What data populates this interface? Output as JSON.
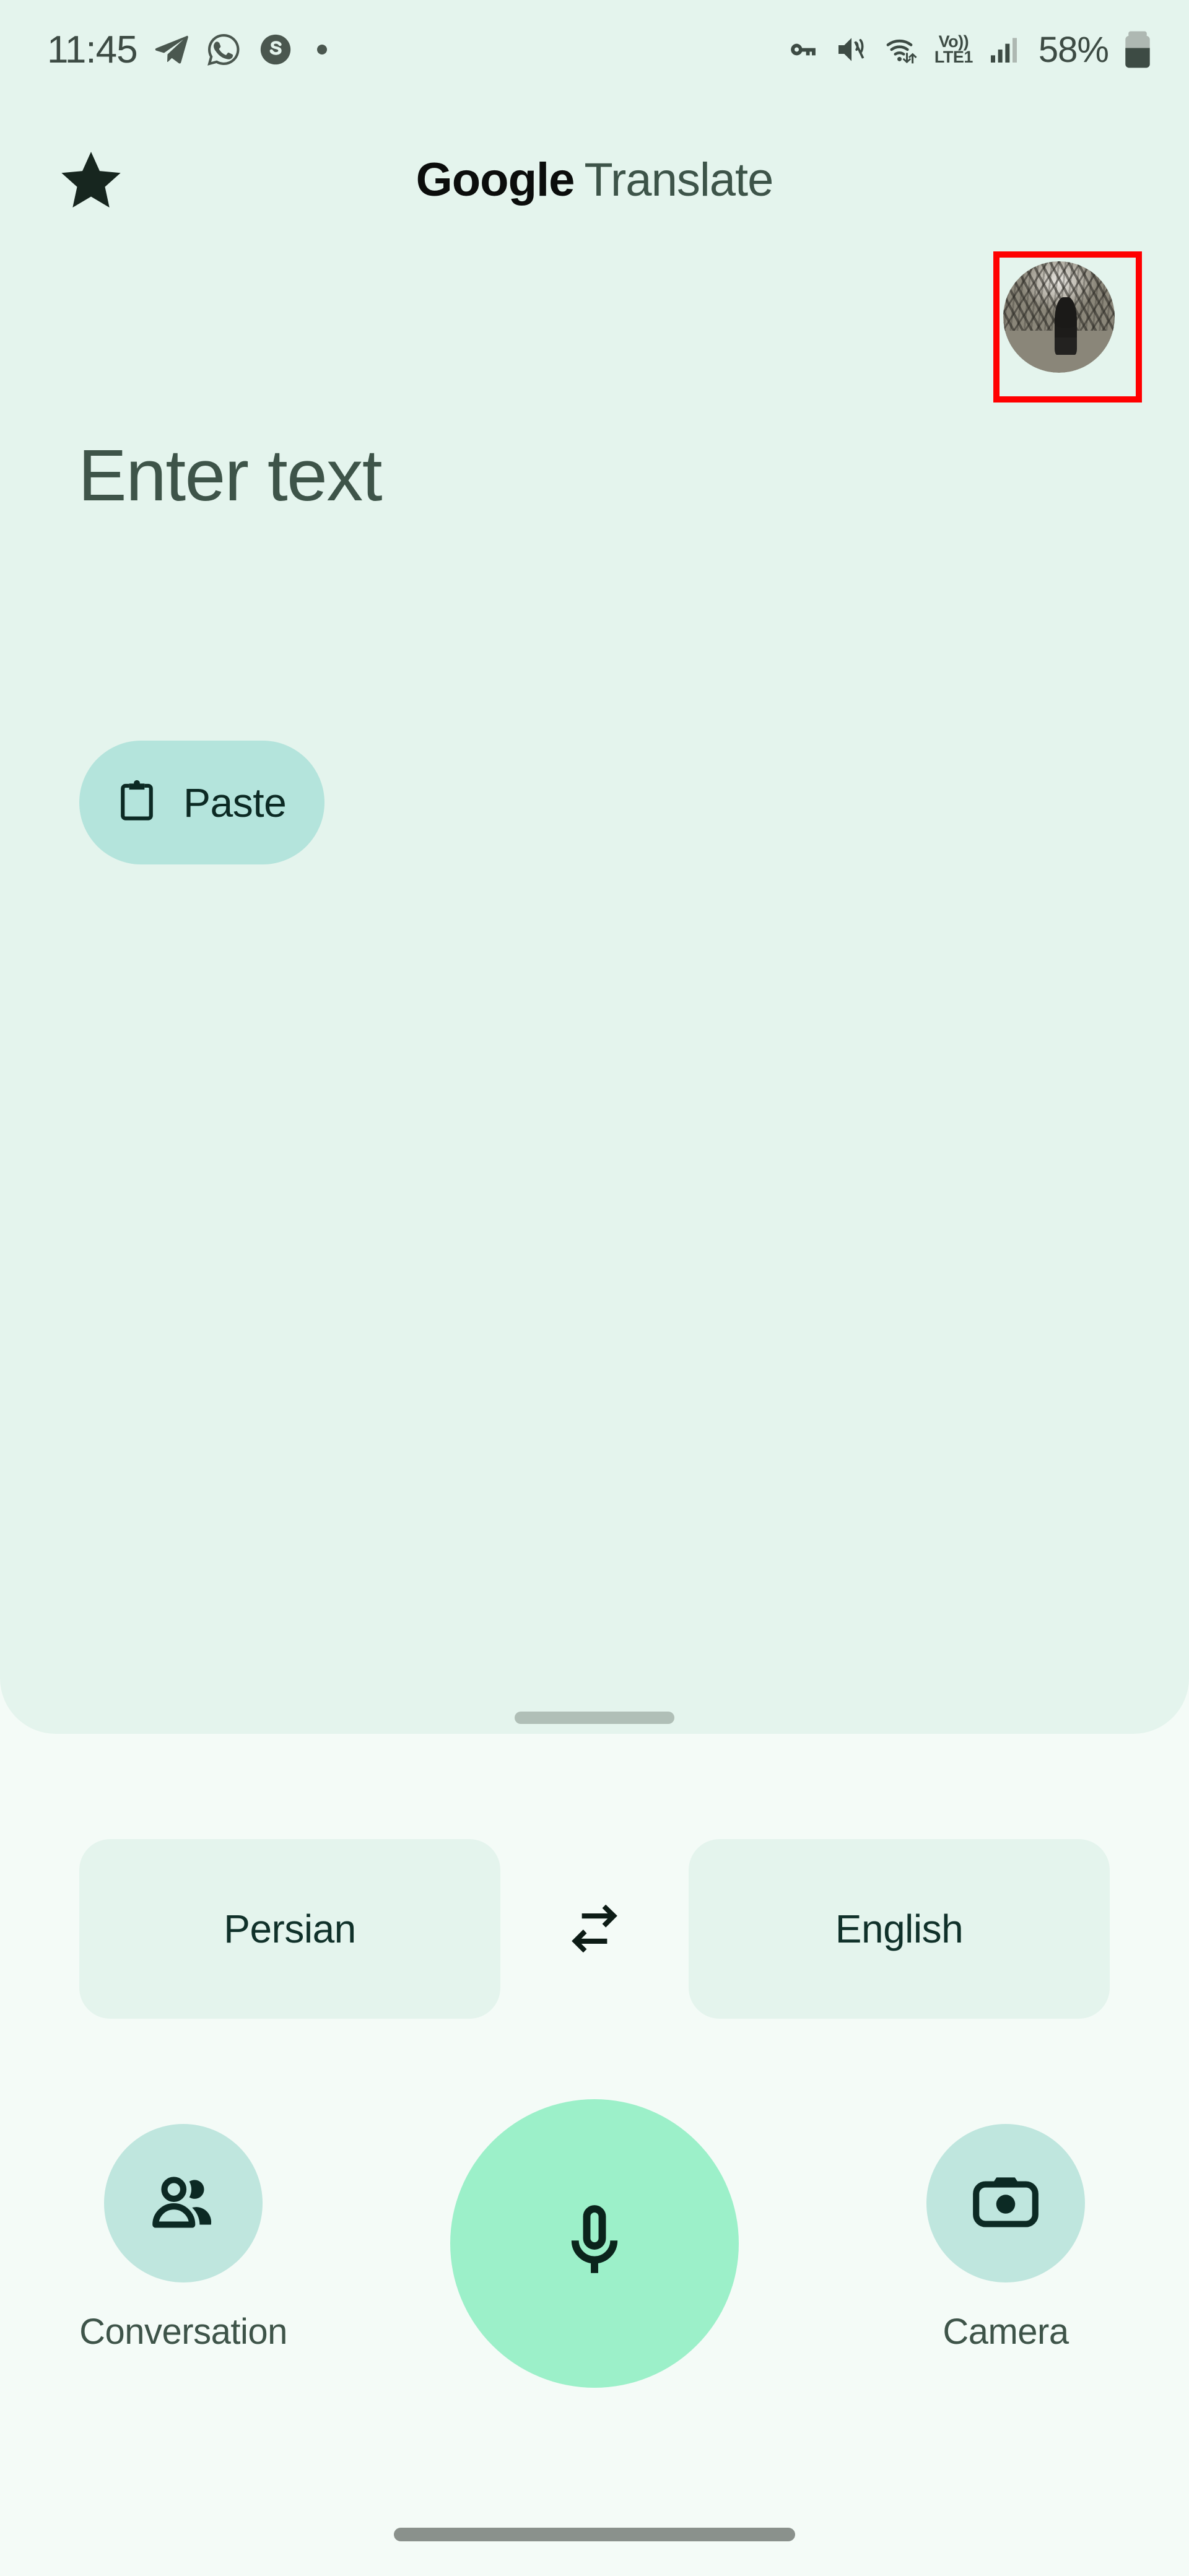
{
  "status_bar": {
    "time": "11:45",
    "left_icons": [
      "telegram-icon",
      "whatsapp-icon",
      "skype-icon",
      "notification-dot"
    ],
    "right_icons": [
      "vpn-key-icon",
      "volume-off-vibrate-icon",
      "wifi-data-icon",
      "volte-icon",
      "signal-bars-icon"
    ],
    "volte_top": "Vo))",
    "volte_bottom": "LTE1",
    "battery_percent": "58%",
    "battery_icon": "battery-icon"
  },
  "header": {
    "star_icon": "star-icon",
    "title_bold": "Google",
    "title_light": "Translate",
    "avatar": "profile-avatar",
    "highlight_color": "#ff0000"
  },
  "input": {
    "placeholder": "Enter text",
    "paste_label": "Paste",
    "paste_icon": "clipboard-icon"
  },
  "languages": {
    "source": "Persian",
    "target": "English",
    "swap_icon": "swap-horizontal-icon"
  },
  "actions": {
    "conversation_label": "Conversation",
    "conversation_icon": "people-icon",
    "mic_icon": "microphone-icon",
    "camera_label": "Camera",
    "camera_icon": "camera-icon"
  },
  "colors": {
    "sheet_bg": "#e4f4ed",
    "page_bg": "#f4fbf7",
    "paste_chip": "#b4e4dc",
    "mic_fab": "#9cf0c9",
    "side_circle": "#bfe6de",
    "text_dark": "#10312a",
    "text_muted": "#3e5449"
  }
}
